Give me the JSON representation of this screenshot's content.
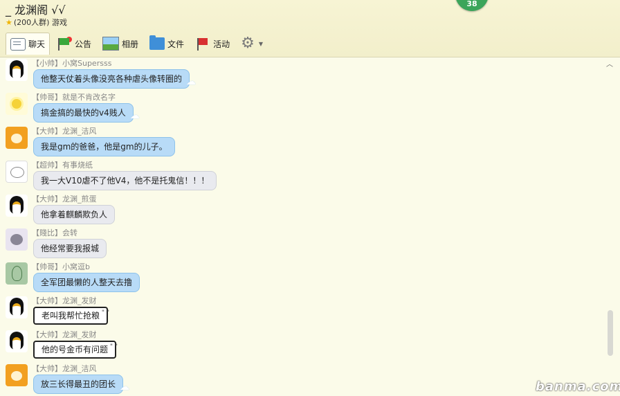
{
  "header": {
    "title": "_ 龙渊阁 √√",
    "group_info": "(200人群) 游戏",
    "badge_count": "38"
  },
  "tabs": [
    {
      "label": "聊天",
      "icon": "chat-icon",
      "active": true
    },
    {
      "label": "公告",
      "icon": "announcement-flag-icon",
      "active": false
    },
    {
      "label": "相册",
      "icon": "album-icon",
      "active": false
    },
    {
      "label": "文件",
      "icon": "folder-icon",
      "active": false
    },
    {
      "label": "活动",
      "icon": "activity-flag-icon",
      "active": false
    }
  ],
  "messages": [
    {
      "name": "【小帅】小窝Supersss",
      "text": "他整天仗着头像没亮各种虐头像转圈的",
      "avatar": "penguin"
    },
    {
      "name": "【帅哥】就是不肯改名字",
      "text": "搞金搞的最快的v4贱人",
      "avatar": "sun"
    },
    {
      "name": "【大帅】龙渊_洁风",
      "text": "我是gm的爸爸，他是gm的儿子。",
      "avatar": "orange"
    },
    {
      "name": "【超帅】有事烧纸",
      "text": "我一大V10虐不了他V4，他不是托鬼信！！！",
      "avatar": "cat"
    },
    {
      "name": "【大帅】龙渊_煎蛋",
      "text": "他拿着麒麟欺负人",
      "avatar": "penguin"
    },
    {
      "name": "【賤比】会转",
      "text": "他经常要我报城",
      "avatar": "mouse"
    },
    {
      "name": "【帅哥】小窝逗b",
      "text": "全军团最懒的人整天去撸",
      "avatar": "green"
    },
    {
      "name": "【大帅】龙渊_发财",
      "text": "老叫我帮忙抢粮",
      "avatar": "penguin"
    },
    {
      "name": "【大帅】龙渊_发财",
      "text": "他的号金币有问题",
      "avatar": "penguin"
    },
    {
      "name": "【大帅】龙渊_洁风",
      "text": "放三长得最丑的团长",
      "avatar": "orange"
    }
  ],
  "watermark": "banma.com"
}
